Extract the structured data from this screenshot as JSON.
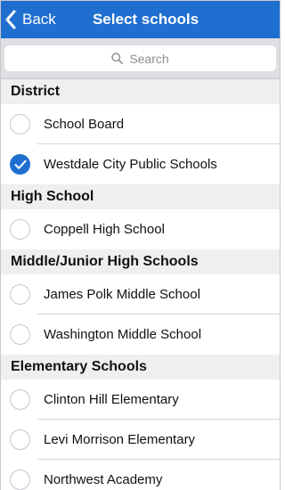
{
  "navbar": {
    "back_label": "Back",
    "title": "Select schools"
  },
  "search": {
    "placeholder": "Search"
  },
  "sections": [
    {
      "header": "District",
      "items": [
        {
          "label": "School Board",
          "checked": false
        },
        {
          "label": "Westdale City Public Schools",
          "checked": true
        }
      ]
    },
    {
      "header": "High School",
      "items": [
        {
          "label": "Coppell High School",
          "checked": false
        }
      ]
    },
    {
      "header": "Middle/Junior High Schools",
      "items": [
        {
          "label": "James Polk Middle School",
          "checked": false
        },
        {
          "label": "Washington Middle School",
          "checked": false
        }
      ]
    },
    {
      "header": "Elementary Schools",
      "items": [
        {
          "label": "Clinton Hill Elementary",
          "checked": false
        },
        {
          "label": "Levi Morrison Elementary",
          "checked": false
        },
        {
          "label": "Northwest Academy",
          "checked": false
        }
      ]
    }
  ],
  "colors": {
    "accent": "#1f6fd0",
    "section_bg": "#efeff2",
    "search_bar_bg": "#dedee3"
  },
  "icons": {
    "back": "chevron-left-icon",
    "search": "magnifier-icon",
    "checked": "checkmark-icon",
    "unchecked": "empty-circle-icon"
  }
}
